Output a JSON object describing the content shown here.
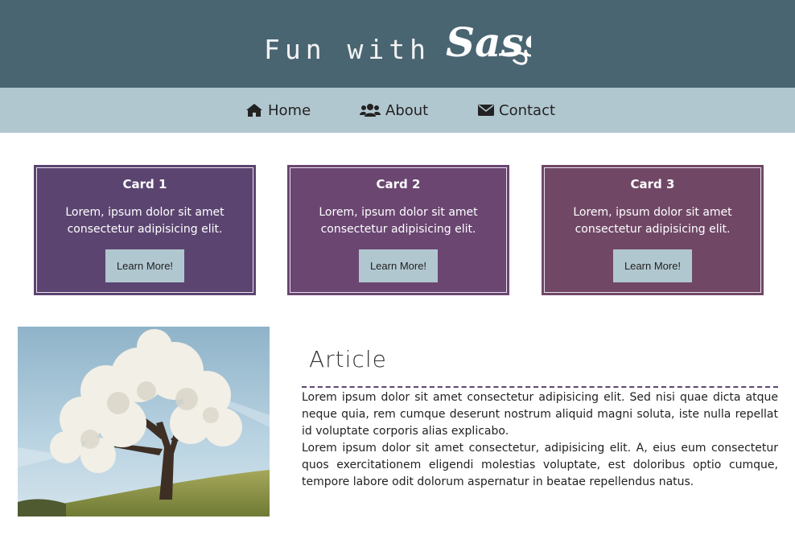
{
  "header": {
    "title": "Fun with",
    "logo_name": "Sass"
  },
  "nav": {
    "items": [
      {
        "label": "Home",
        "icon": "home-icon"
      },
      {
        "label": "About",
        "icon": "users-icon"
      },
      {
        "label": "Contact",
        "icon": "envelope-icon"
      }
    ]
  },
  "cards": [
    {
      "title": "Card 1",
      "text": "Lorem, ipsum dolor sit amet consectetur adipisicing elit.",
      "button": "Learn More!",
      "color": "#5b4570"
    },
    {
      "title": "Card 2",
      "text": "Lorem, ipsum dolor sit amet consectetur adipisicing elit.",
      "button": "Learn More!",
      "color": "#6a4671"
    },
    {
      "title": "Card 3",
      "text": "Lorem, ipsum dolor sit amet consectetur adipisicing elit.",
      "button": "Learn More!",
      "color": "#704866"
    }
  ],
  "article": {
    "heading": "Article",
    "paragraphs": [
      "Lorem ipsum dolor sit amet consectetur adipisicing elit. Sed nisi quae dicta atque neque quia, rem cumque deserunt nostrum aliquid magni soluta, iste nulla repellat id voluptate corporis alias explicabo.",
      "Lorem ipsum dolor sit amet consectetur, adipisicing elit. A, eius eum consectetur quos exercitationem eligendi molestias voluptate, est doloribus optio cumque, tempore labore odit dolorum aspernatur in beatae repellendus natus."
    ]
  },
  "colors": {
    "header_bg": "#4a6572",
    "nav_bg": "#b1c7cf",
    "button_bg": "#b1c7cf",
    "rule": "#5b4570"
  }
}
